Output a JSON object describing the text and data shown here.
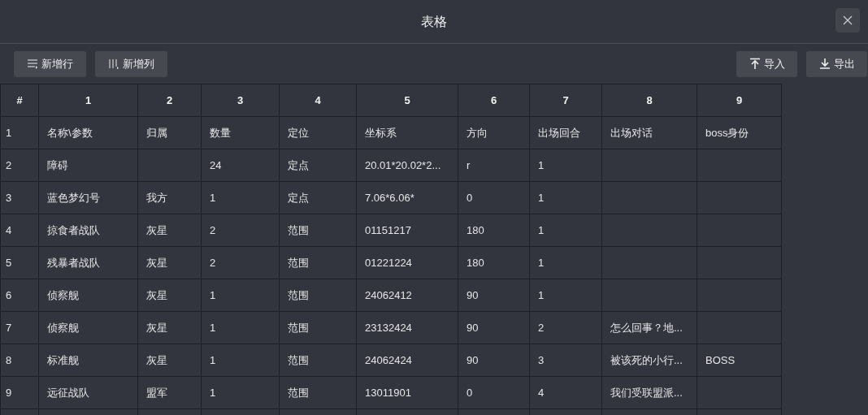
{
  "window": {
    "title": "表格"
  },
  "toolbar": {
    "left_buttons": [
      {
        "kind": "add-row",
        "label": "新增行"
      },
      {
        "kind": "add-column",
        "label": "新增列"
      }
    ],
    "right_buttons": [
      {
        "kind": "import",
        "label": "导入"
      },
      {
        "kind": "export",
        "label": "导出"
      }
    ]
  },
  "table": {
    "columns": [
      "#",
      "1",
      "2",
      "3",
      "4",
      "5",
      "6",
      "7",
      "8",
      "9"
    ],
    "rows": [
      [
        "1",
        "名称\\参数",
        "归属",
        "数量",
        "定位",
        "坐标系",
        "方向",
        "出场回合",
        "出场对话",
        "boss身份"
      ],
      [
        "2",
        "障碍",
        "",
        "24",
        "定点",
        "20.01*20.02*2...",
        "r",
        "1",
        "",
        ""
      ],
      [
        "3",
        "蓝色梦幻号",
        "我方",
        "1",
        "定点",
        "7.06*6.06*",
        "0",
        "1",
        "",
        ""
      ],
      [
        "4",
        "掠食者战队",
        "灰星",
        "2",
        "范围",
        "01151217",
        "180",
        "1",
        "",
        ""
      ],
      [
        "5",
        "残暴者战队",
        "灰星",
        "2",
        "范围",
        "01221224",
        "180",
        "1",
        "",
        ""
      ],
      [
        "6",
        "侦察舰",
        "灰星",
        "1",
        "范围",
        "24062412",
        "90",
        "1",
        "",
        ""
      ],
      [
        "7",
        "侦察舰",
        "灰星",
        "1",
        "范围",
        "23132424",
        "90",
        "2",
        "怎么回事？地...",
        ""
      ],
      [
        "8",
        "标准舰",
        "灰星",
        "1",
        "范围",
        "24062424",
        "90",
        "3",
        "被该死的小行...",
        "BOSS"
      ],
      [
        "9",
        "远征战队",
        "盟军",
        "1",
        "范围",
        "13011901",
        "0",
        "4",
        "我们受联盟派...",
        ""
      ]
    ]
  }
}
